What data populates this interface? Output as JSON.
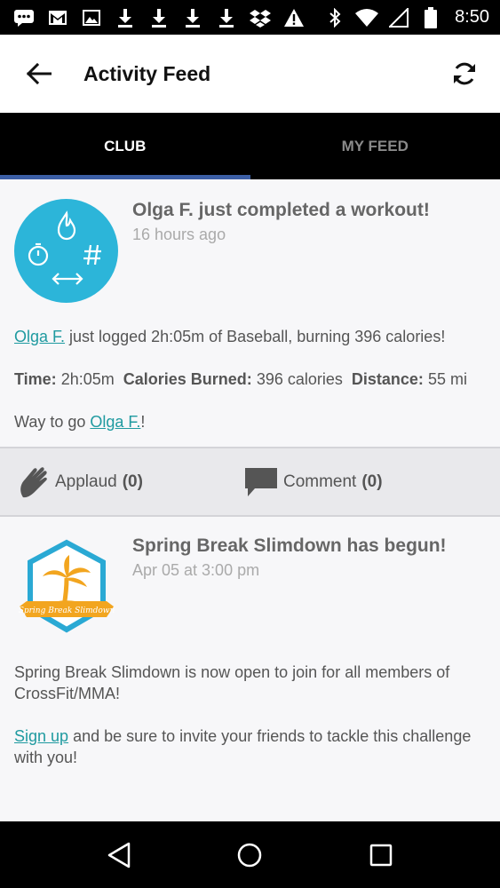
{
  "status_bar": {
    "time": "8:50",
    "icons": [
      "message-icon",
      "gmail-icon",
      "image-icon",
      "download-icon",
      "download-icon",
      "download-icon",
      "download-icon",
      "dropbox-icon",
      "warning-icon",
      "bluetooth-icon",
      "wifi-icon",
      "signal-icon",
      "battery-icon"
    ]
  },
  "app_bar": {
    "title": "Activity Feed",
    "back_icon": "arrow-left-icon",
    "refresh_icon": "refresh-icon"
  },
  "tabs": [
    {
      "label": "CLUB",
      "active": true
    },
    {
      "label": "MY FEED",
      "active": false
    }
  ],
  "feed": {
    "post1": {
      "title": "Olga F. just completed a workout!",
      "time": "16 hours ago",
      "user_link": "Olga F.",
      "summary": "just logged 2h:05m of Baseball, burning 396 calories!",
      "time_label": "Time:",
      "time_value": "2h:05m",
      "calories_label": "Calories Burned:",
      "calories_value": "396 calories",
      "distance_label": "Distance:",
      "distance_value": "55 mi",
      "cheer_prefix": "Way to go",
      "cheer_link": "Olga F.",
      "cheer_suffix": "!",
      "applaud_label": "Applaud",
      "applaud_count": "(0)",
      "comment_label": "Comment",
      "comment_count": "(0)"
    },
    "post2": {
      "title": "Spring Break Slimdown has begun!",
      "time": "Apr 05 at 3:00 pm",
      "badge_text": "Spring Break Slimdown",
      "body": "Spring Break Slimdown is now open to join for all members of CrossFit/MMA!",
      "signup_link": "Sign up",
      "signup_rest": "and be sure to invite your friends to tackle this challenge with you!"
    }
  },
  "nav_bar": {
    "icons": [
      "back-triangle-icon",
      "home-circle-icon",
      "recents-square-icon"
    ]
  },
  "colors": {
    "accent_link": "#1f9aa0",
    "tab_indicator": "#3c5fa6",
    "avatar_bg": "#2cb5d9"
  }
}
